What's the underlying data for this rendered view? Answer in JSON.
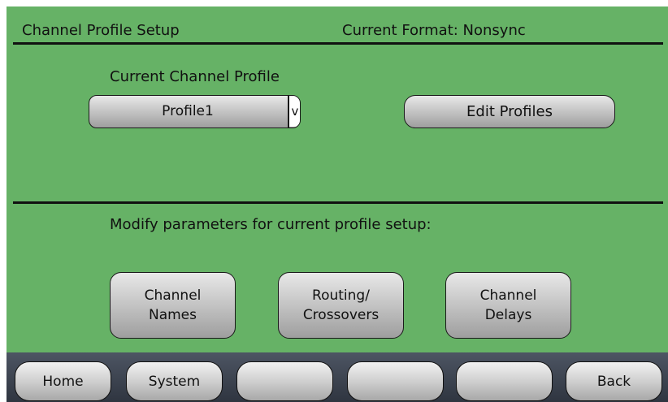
{
  "header": {
    "title": "Channel Profile Setup",
    "format": "Current Format: Nonsync"
  },
  "profile_section": {
    "label": "Current Channel Profile",
    "dropdown_value": "Profile1",
    "dropdown_arrow": "v",
    "edit_button": "Edit Profiles"
  },
  "modify_section": {
    "label": "Modify parameters for current profile setup:",
    "buttons": [
      {
        "line1": "Channel",
        "line2": "Names"
      },
      {
        "line1": "Routing/",
        "line2": "Crossovers"
      },
      {
        "line1": "Channel",
        "line2": "Delays"
      }
    ]
  },
  "nav": {
    "buttons": [
      "Home",
      "System",
      "",
      "",
      "",
      "Back"
    ]
  },
  "colors": {
    "panel_bg": "#66b266",
    "bottom_bar": "#3a404c"
  }
}
